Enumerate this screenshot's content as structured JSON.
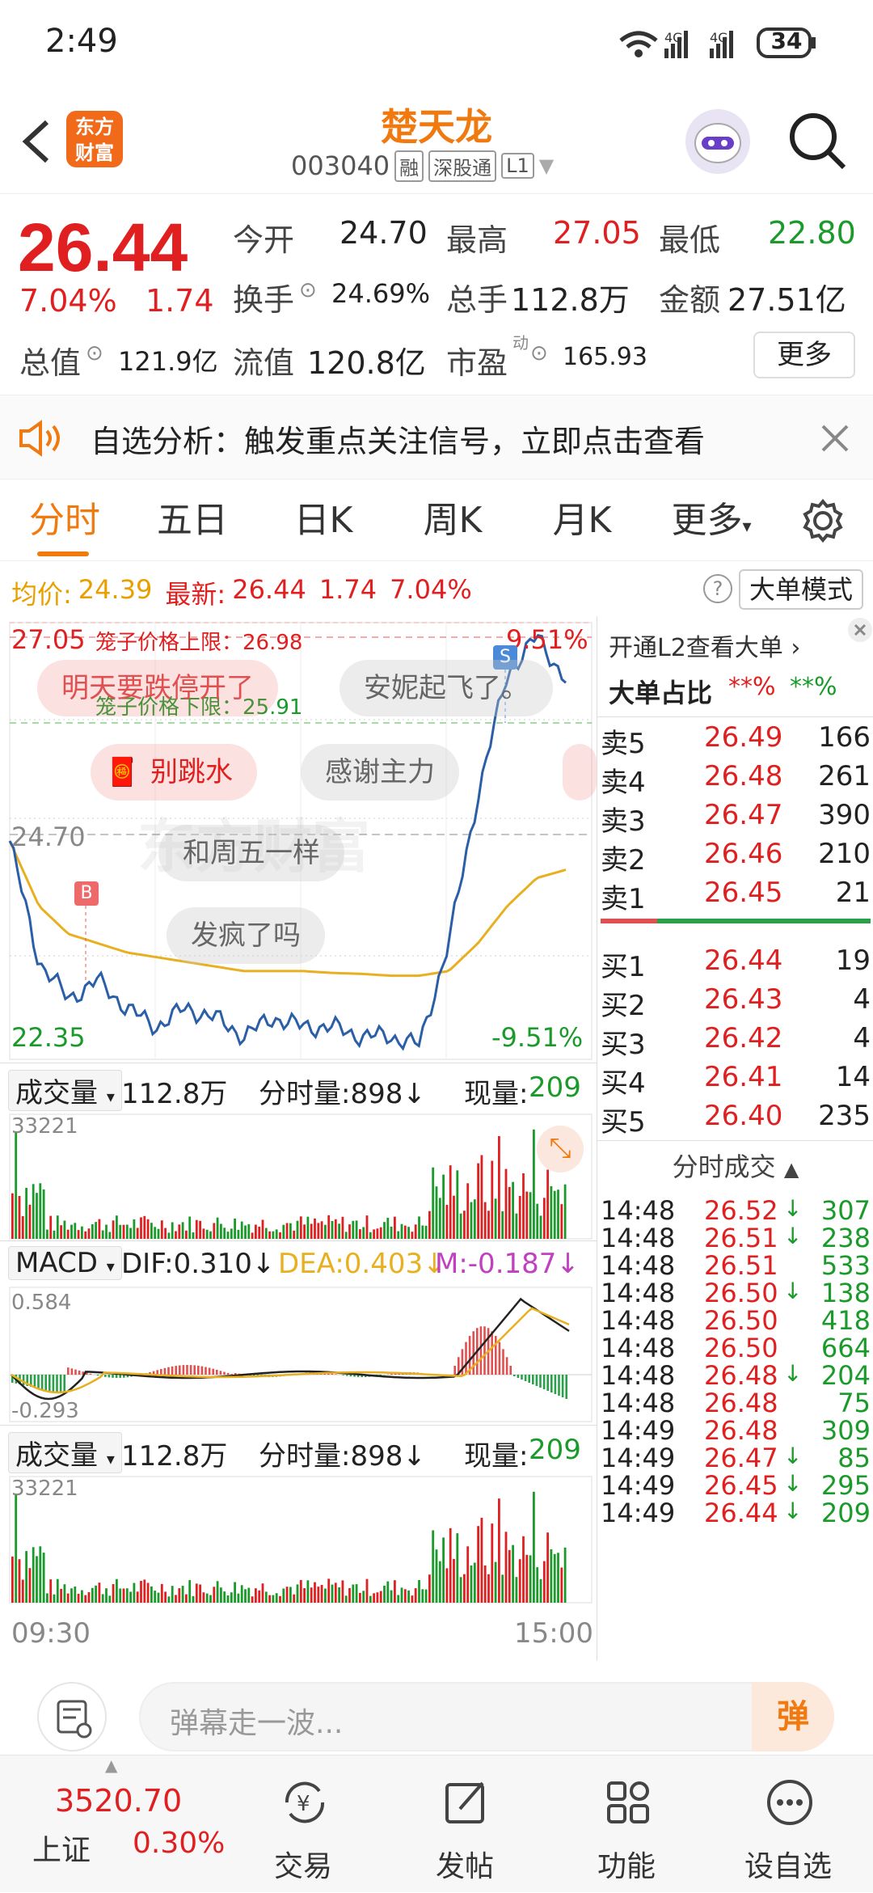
{
  "status": {
    "time": "2:49",
    "battery": "34"
  },
  "header": {
    "title": "楚天龙",
    "code": "003040",
    "badges": [
      "融",
      "深股通",
      "L1"
    ],
    "logo_text": "东方财富"
  },
  "quote": {
    "price": "26.44",
    "change_pct": "7.04%",
    "change": "1.74",
    "open_label": "今开",
    "open": "24.70",
    "high_label": "最高",
    "high": "27.05",
    "low_label": "最低",
    "low": "22.80",
    "turnover_label": "换手",
    "turnover": "24.69%",
    "volume_label": "总手",
    "volume": "112.8万",
    "amount_label": "金额",
    "amount": "27.51亿",
    "mcap_label": "总值",
    "mcap": "121.9亿",
    "float_label": "流值",
    "float": "120.8亿",
    "pe_label": "市盈",
    "pe_sup": "动",
    "pe": "165.93",
    "more_label": "更多"
  },
  "banner": {
    "text": "自选分析：触发重点关注信号，立即点击查看"
  },
  "tabs": [
    "分时",
    "五日",
    "日K",
    "周K",
    "月K",
    "更多"
  ],
  "info": {
    "avg_label": "均价:",
    "avg": "24.39",
    "last_label": "最新:",
    "last": "26.44",
    "chg": "1.74",
    "chg_pct": "7.04%",
    "mode_label": "大单模式"
  },
  "chart": {
    "upper_left": "27.05",
    "upper_right": "9.51%",
    "lower_left": "22.35",
    "lower_right": "-9.51%",
    "mid_label": "24.70",
    "cage_up": "笼子价格上限：26.98",
    "cage_down": "笼子价格下限：25.91",
    "watermark": "东方财富",
    "marker_b": "B",
    "marker_s": "S",
    "danmaku": [
      "明天要跌停开了",
      "安妮起飞了。",
      "别跳水",
      "感谢主力",
      "和周五一样",
      "发疯了吗"
    ]
  },
  "chart_data": {
    "type": "line",
    "title": "",
    "xlabel": "",
    "ylabel": "",
    "x_range": [
      "09:30",
      "15:00"
    ],
    "ylim": [
      22.35,
      27.05
    ],
    "series": [
      {
        "values": [
          24.7,
          23.4,
          23.0,
          23.2,
          22.9,
          22.7,
          22.9,
          22.8,
          22.6,
          22.8,
          22.7,
          22.7,
          22.6,
          22.6,
          22.5,
          23.6,
          25.2,
          26.5,
          26.9,
          26.44
        ]
      },
      {
        "values": [
          24.7,
          24.0,
          23.7,
          23.6,
          23.5,
          23.45,
          23.4,
          23.35,
          23.3,
          23.3,
          23.3,
          23.28,
          23.27,
          23.25,
          23.25,
          23.3,
          23.6,
          24.0,
          24.3,
          24.39
        ]
      }
    ]
  },
  "volume_panel": {
    "label": "成交量",
    "total": "112.8万",
    "fs_label": "分时量:898↓",
    "now_label": "现量:",
    "now": "209",
    "max": "33221"
  },
  "macd_panel": {
    "label": "MACD",
    "dif": "DIF:0.310↓",
    "dea": "DEA:0.403↓",
    "m": "M:-0.187↓",
    "top": "0.584",
    "bottom": "-0.293"
  },
  "volume_panel2": {
    "label": "成交量",
    "total": "112.8万",
    "fs_label": "分时量:898↓",
    "now_label": "现量:",
    "now": "209",
    "max": "33221"
  },
  "time_axis": {
    "start": "09:30",
    "end": "15:00"
  },
  "orderbook": {
    "l2_link": "开通L2查看大单",
    "big_ratio_label": "大单占比",
    "big_ratio_red": "**%",
    "big_ratio_green": "**%",
    "asks": [
      {
        "label": "卖5",
        "price": "26.49",
        "vol": "166"
      },
      {
        "label": "卖4",
        "price": "26.48",
        "vol": "261"
      },
      {
        "label": "卖3",
        "price": "26.47",
        "vol": "390"
      },
      {
        "label": "卖2",
        "price": "26.46",
        "vol": "210"
      },
      {
        "label": "卖1",
        "price": "26.45",
        "vol": "21"
      }
    ],
    "bids": [
      {
        "label": "买1",
        "price": "26.44",
        "vol": "19"
      },
      {
        "label": "买2",
        "price": "26.43",
        "vol": "4"
      },
      {
        "label": "买3",
        "price": "26.42",
        "vol": "4"
      },
      {
        "label": "买4",
        "price": "26.41",
        "vol": "14"
      },
      {
        "label": "买5",
        "price": "26.40",
        "vol": "235"
      }
    ],
    "trades_label": "分时成交",
    "trades": [
      {
        "time": "14:48",
        "price": "26.52",
        "arrow": "↓",
        "vol": "307"
      },
      {
        "time": "14:48",
        "price": "26.51",
        "arrow": "↓",
        "vol": "238"
      },
      {
        "time": "14:48",
        "price": "26.51",
        "arrow": "",
        "vol": "533"
      },
      {
        "time": "14:48",
        "price": "26.50",
        "arrow": "↓",
        "vol": "138"
      },
      {
        "time": "14:48",
        "price": "26.50",
        "arrow": "",
        "vol": "418"
      },
      {
        "time": "14:48",
        "price": "26.50",
        "arrow": "",
        "vol": "664"
      },
      {
        "time": "14:48",
        "price": "26.48",
        "arrow": "↓",
        "vol": "204"
      },
      {
        "time": "14:48",
        "price": "26.48",
        "arrow": "",
        "vol": "75"
      },
      {
        "time": "14:49",
        "price": "26.48",
        "arrow": "",
        "vol": "309"
      },
      {
        "time": "14:49",
        "price": "26.47",
        "arrow": "↓",
        "vol": "85"
      },
      {
        "time": "14:49",
        "price": "26.45",
        "arrow": "↓",
        "vol": "295"
      },
      {
        "time": "14:49",
        "price": "26.44",
        "arrow": "↓",
        "vol": "209"
      }
    ]
  },
  "input": {
    "placeholder": "弹幕走一波...",
    "danmu_btn": "弹"
  },
  "bottomnav": {
    "index_value": "3520.70",
    "index_name": "上证",
    "index_pct": "0.30%",
    "items": [
      "交易",
      "发帖",
      "功能",
      "设自选"
    ]
  },
  "colors": {
    "up": "#e02020",
    "down": "#1a9a2a",
    "accent": "#f07a10",
    "price_line": "#2a5fa8",
    "avg_line": "#e8b020"
  }
}
